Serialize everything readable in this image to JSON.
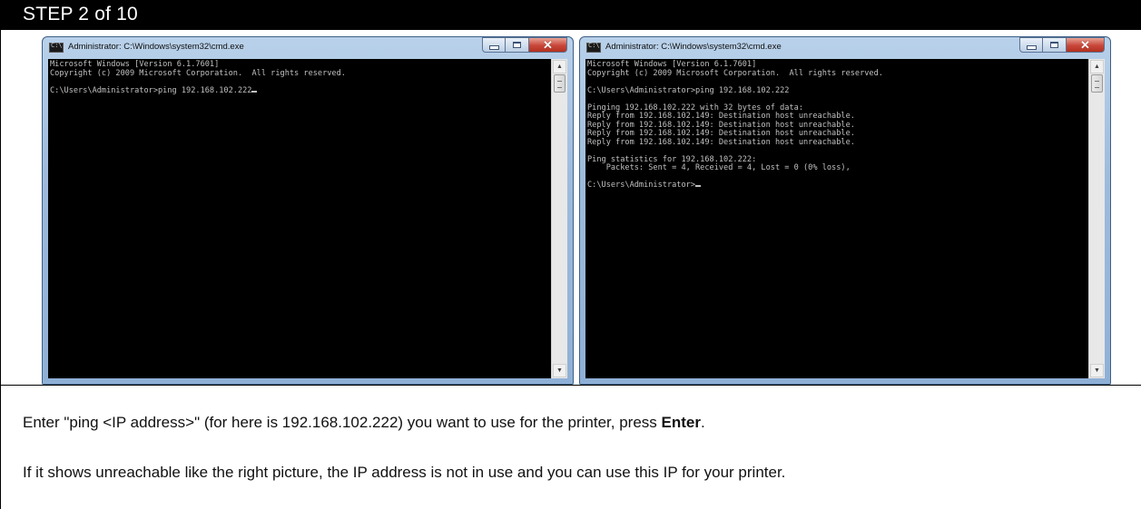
{
  "step": {
    "title": "STEP 2 of 10"
  },
  "windows": [
    {
      "title": "Administrator: C:\\Windows\\system32\\cmd.exe",
      "lines": [
        "Microsoft Windows [Version 6.1.7601]",
        "Copyright (c) 2009 Microsoft Corporation.  All rights reserved.",
        "",
        "C:\\Users\\Administrator>ping 192.168.102.222"
      ],
      "cursor_after_last": true
    },
    {
      "title": "Administrator: C:\\Windows\\system32\\cmd.exe",
      "lines": [
        "Microsoft Windows [Version 6.1.7601]",
        "Copyright (c) 2009 Microsoft Corporation.  All rights reserved.",
        "",
        "C:\\Users\\Administrator>ping 192.168.102.222",
        "",
        "Pinging 192.168.102.222 with 32 bytes of data:",
        "Reply from 192.168.102.149: Destination host unreachable.",
        "Reply from 192.168.102.149: Destination host unreachable.",
        "Reply from 192.168.102.149: Destination host unreachable.",
        "Reply from 192.168.102.149: Destination host unreachable.",
        "",
        "Ping statistics for 192.168.102.222:",
        "    Packets: Sent = 4, Received = 4, Lost = 0 (0% loss),",
        "",
        "C:\\Users\\Administrator>"
      ],
      "cursor_after_last": true
    }
  ],
  "instructions": {
    "line1_before": "Enter \"ping <IP address>\" (for here is 192.168.102.222) you want to use for the printer, press ",
    "line1_bold": "Enter",
    "line1_after": ".",
    "line2": "If it shows unreachable like the right picture, the IP address is not in use and you can use this IP for your printer."
  },
  "icons": {
    "console": "cmd-icon",
    "minimize": "minimize-icon",
    "maximize": "maximize-icon",
    "close": "close-icon",
    "scroll_up": "chevron-up-icon",
    "scroll_down": "chevron-down-icon"
  },
  "colors": {
    "step_bar": "#000000",
    "console_bg": "#000000",
    "console_text": "#c0c0c0",
    "close_button": "#c8463a"
  }
}
